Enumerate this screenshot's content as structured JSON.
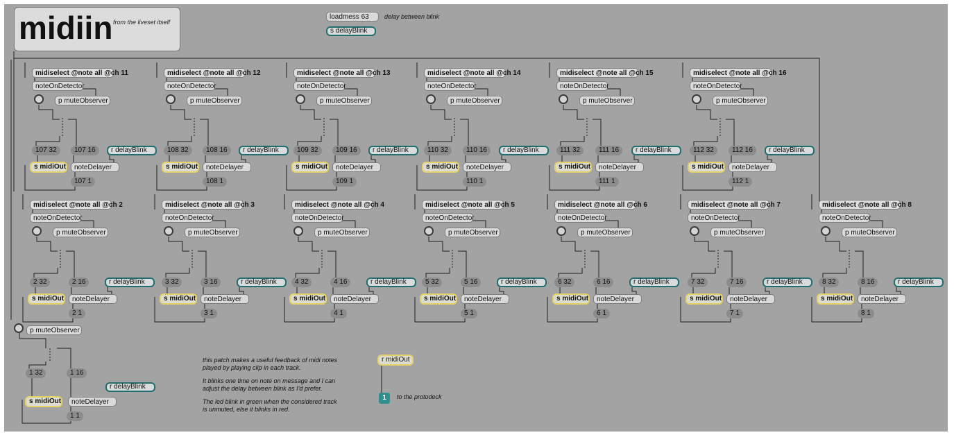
{
  "header": {
    "title": "midiin",
    "subtitle": "from the liveset itself",
    "loadmess": "loadmess 63",
    "loadmess_comment": "delay between blink",
    "send_delay": "s delayBlink"
  },
  "labels": {
    "midiselect_prefix": "midiselect @note all @ch ",
    "note_on_detector": "noteOnDetector",
    "mute_observer": "p muteObserver",
    "recv_delay": "r delayBlink",
    "send_midi": "s midiOut",
    "note_delayer": "noteDelayer"
  },
  "channels": [
    {
      "ch": "11",
      "a": "107 32",
      "b": "107 16",
      "c": "107 1"
    },
    {
      "ch": "12",
      "a": "108 32",
      "b": "108 16",
      "c": "108 1"
    },
    {
      "ch": "13",
      "a": "109 32",
      "b": "109 16",
      "c": "109 1"
    },
    {
      "ch": "14",
      "a": "110 32",
      "b": "110 16",
      "c": "110 1"
    },
    {
      "ch": "15",
      "a": "111 32",
      "b": "111 16",
      "c": "111 1"
    },
    {
      "ch": "16",
      "a": "112 32",
      "b": "112 16",
      "c": "112 1"
    },
    {
      "ch": "2",
      "a": "2 32",
      "b": "2 16",
      "c": "2 1"
    },
    {
      "ch": "3",
      "a": "3 32",
      "b": "3 16",
      "c": "3 1"
    },
    {
      "ch": "4",
      "a": "4 32",
      "b": "4 16",
      "c": "4 1"
    },
    {
      "ch": "5",
      "a": "5 32",
      "b": "5 16",
      "c": "5 1"
    },
    {
      "ch": "6",
      "a": "6 32",
      "b": "6 16",
      "c": "6 1"
    },
    {
      "ch": "7",
      "a": "7 32",
      "b": "7 16",
      "c": "7 1"
    },
    {
      "ch": "8",
      "a": "8 32",
      "b": "8 16",
      "c": "8 1"
    }
  ],
  "channel1": {
    "a": "1 32",
    "b": "1 16",
    "c": "1 1"
  },
  "footer": {
    "recv_midi": "r midiOut",
    "out_number": "1",
    "out_comment": "to the protodeck",
    "comments": [
      "this patch makes a useful feedback of midi notes",
      "played by playing clip  in each track.",
      "It blinks one time on note on message and I can",
      "adjust the delay between blink as I'd prefer.",
      "The led blink in green when the considered track",
      "is unmuted, else it blinks in red."
    ]
  },
  "colors": {
    "background": "#a3a3a3",
    "send_outline": "#e5d16a",
    "receive_outline": "#226e6e",
    "message_box": "#8c8c8c"
  }
}
